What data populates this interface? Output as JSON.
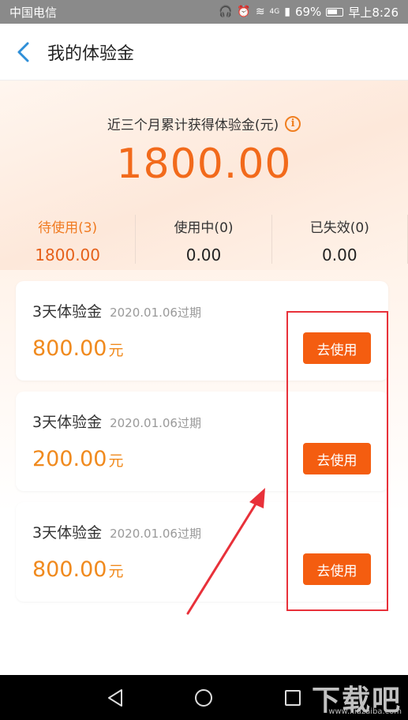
{
  "status_bar": {
    "carrier": "中国电信",
    "signal": "4G",
    "battery": "69%",
    "time": "早上8:26"
  },
  "header": {
    "title": "我的体验金"
  },
  "summary": {
    "label": "近三个月累计获得体验金(元)",
    "total": "1800.00",
    "stats": [
      {
        "label": "待使用(3)",
        "value": "1800.00"
      },
      {
        "label": "使用中(0)",
        "value": "0.00"
      },
      {
        "label": "已失效(0)",
        "value": "0.00"
      }
    ]
  },
  "cards": [
    {
      "name": "3天体验金",
      "expire": "2020.01.06过期",
      "amount": "800.00",
      "unit": "元",
      "button": "去使用"
    },
    {
      "name": "3天体验金",
      "expire": "2020.01.06过期",
      "amount": "200.00",
      "unit": "元",
      "button": "去使用"
    },
    {
      "name": "3天体验金",
      "expire": "2020.01.06过期",
      "amount": "800.00",
      "unit": "元",
      "button": "去使用"
    }
  ],
  "watermark": {
    "text": "下载吧",
    "url": "www.xiazaiba.com"
  },
  "colors": {
    "accent": "#f45d10",
    "amount": "#f08a1e",
    "total": "#f26a1b",
    "annotation": "#e8313a",
    "back_arrow": "#2f8fd8"
  }
}
